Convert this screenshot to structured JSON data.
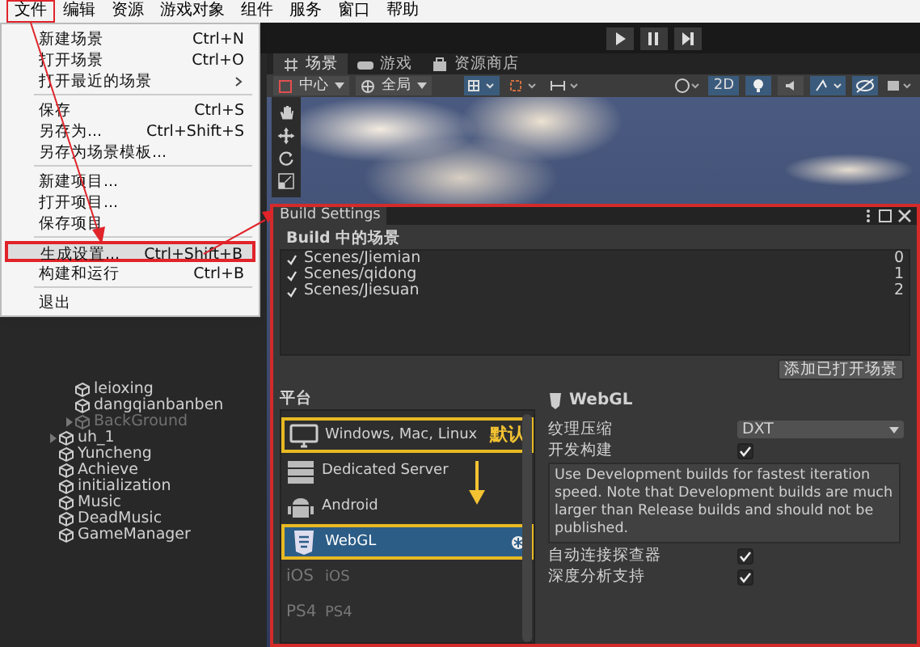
{
  "menubar": {
    "items": [
      {
        "label": "文件",
        "selected": true
      },
      {
        "label": "编辑",
        "selected": false
      },
      {
        "label": "资源",
        "selected": false
      },
      {
        "label": "游戏对象",
        "selected": false
      },
      {
        "label": "组件",
        "selected": false
      },
      {
        "label": "服务",
        "selected": false
      },
      {
        "label": "窗口",
        "selected": false
      },
      {
        "label": "帮助",
        "selected": false
      }
    ]
  },
  "file_menu": {
    "items": [
      {
        "kind": "item",
        "label": "新建场景",
        "shortcut": "Ctrl+N",
        "selected": false
      },
      {
        "kind": "item",
        "label": "打开场景",
        "shortcut": "Ctrl+O",
        "selected": false
      },
      {
        "kind": "submenu",
        "label": "打开最近的场景",
        "selected": false
      },
      {
        "kind": "separator"
      },
      {
        "kind": "item",
        "label": "保存",
        "shortcut": "Ctrl+S",
        "selected": false
      },
      {
        "kind": "item",
        "label": "另存为...",
        "shortcut": "Ctrl+Shift+S",
        "selected": false
      },
      {
        "kind": "item",
        "label": "另存为场景模板...",
        "selected": false
      },
      {
        "kind": "separator"
      },
      {
        "kind": "item",
        "label": "新建项目...",
        "selected": false
      },
      {
        "kind": "item",
        "label": "打开项目...",
        "selected": false
      },
      {
        "kind": "item",
        "label": "保存项目",
        "selected": false
      },
      {
        "kind": "separator"
      },
      {
        "kind": "item",
        "label": "生成设置...",
        "shortcut": "Ctrl+Shift+B",
        "selected": true
      },
      {
        "kind": "item",
        "label": "构建和运行",
        "shortcut": "Ctrl+B",
        "selected": false
      },
      {
        "kind": "separator"
      },
      {
        "kind": "item",
        "label": "退出",
        "selected": false
      }
    ]
  },
  "scene_tabs": [
    {
      "label": "场景",
      "selected": true
    },
    {
      "label": "游戏",
      "selected": false
    },
    {
      "label": "资源商店",
      "selected": false
    }
  ],
  "scene_toolbar": {
    "pivot": "中心",
    "space": "全局",
    "view_mode": "2D"
  },
  "hierarchy": {
    "nested_items": [
      {
        "label": "leioxing",
        "expandable": false,
        "disabled": false
      },
      {
        "label": "dangqianbanben",
        "expandable": false,
        "disabled": false
      },
      {
        "label": "BackGround",
        "expandable": true,
        "disabled": true
      }
    ],
    "items": [
      {
        "label": "uh_1",
        "expandable": true,
        "disabled": false
      },
      {
        "label": "Yuncheng",
        "expandable": false,
        "disabled": false
      },
      {
        "label": "Achieve",
        "expandable": false,
        "disabled": false
      },
      {
        "label": "initialization",
        "expandable": false,
        "disabled": false
      },
      {
        "label": "Music",
        "expandable": false,
        "disabled": false
      },
      {
        "label": "DeadMusic",
        "expandable": false,
        "disabled": false
      },
      {
        "label": "GameManager",
        "expandable": false,
        "disabled": false
      }
    ]
  },
  "build_settings": {
    "title": "Build Settings",
    "scenes_header": "Build 中的场景",
    "scenes": [
      {
        "path": "Scenes/Jiemian",
        "index": "0",
        "checked": true
      },
      {
        "path": "Scenes/qidong",
        "index": "1",
        "checked": true
      },
      {
        "path": "Scenes/Jiesuan",
        "index": "2",
        "checked": true
      }
    ],
    "add_button": "添加已打开场景",
    "platform_header": "平台",
    "platforms": [
      {
        "kind": "monitor",
        "name": "Windows, Mac, Linux",
        "selected": false,
        "highlighted": true,
        "disabled": false,
        "note": "默认"
      },
      {
        "kind": "server",
        "name": "Dedicated Server",
        "selected": false,
        "highlighted": false,
        "disabled": false
      },
      {
        "kind": "android",
        "name": "Android",
        "selected": false,
        "highlighted": false,
        "disabled": false
      },
      {
        "kind": "html5",
        "name": "WebGL",
        "selected": true,
        "highlighted": true,
        "disabled": false,
        "current": true
      },
      {
        "kind": "logo",
        "logo": "iOS",
        "name": "iOS",
        "selected": false,
        "highlighted": false,
        "disabled": true
      },
      {
        "kind": "logo",
        "logo": "PS4",
        "name": "PS4",
        "selected": false,
        "highlighted": false,
        "disabled": true
      }
    ],
    "settings": {
      "title": "WebGL",
      "rows": [
        {
          "kind": "dropdown",
          "label": "纹理压缩",
          "value": "DXT"
        },
        {
          "kind": "checkbox",
          "label": "开发构建",
          "checked": true
        },
        {
          "kind": "help",
          "text": "Use Development builds for fastest iteration speed. Note that Development builds are much larger than Release builds and should not be published."
        },
        {
          "kind": "checkbox",
          "label": "自动连接探查器",
          "checked": true
        },
        {
          "kind": "checkbox",
          "label": "深度分析支持",
          "checked": true
        }
      ]
    }
  }
}
